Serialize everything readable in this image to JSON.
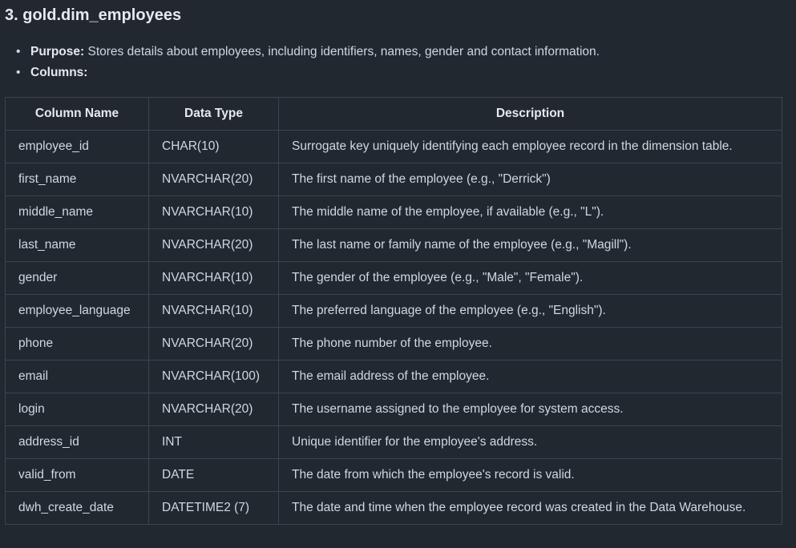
{
  "heading": "3. gold.dim_employees",
  "purpose": {
    "label": "Purpose:",
    "text": " Stores details about employees, including identifiers, names, gender and contact information."
  },
  "columns_label": "Columns:",
  "table": {
    "headers": [
      "Column Name",
      "Data Type",
      "Description"
    ],
    "rows": [
      [
        "employee_id",
        "CHAR(10)",
        "Surrogate key uniquely identifying each employee record in the dimension table."
      ],
      [
        "first_name",
        "NVARCHAR(20)",
        "The first name of the employee (e.g., \"Derrick\")"
      ],
      [
        "middle_name",
        "NVARCHAR(10)",
        "The middle name of the employee, if available (e.g., \"L\")."
      ],
      [
        "last_name",
        "NVARCHAR(20)",
        "The last name or family name of the employee (e.g., \"Magill\")."
      ],
      [
        "gender",
        "NVARCHAR(10)",
        "The gender of the employee (e.g., \"Male\", \"Female\")."
      ],
      [
        "employee_language",
        "NVARCHAR(10)",
        "The preferred language of the employee (e.g., \"English\")."
      ],
      [
        "phone",
        "NVARCHAR(20)",
        "The phone number of the employee."
      ],
      [
        "email",
        "NVARCHAR(100)",
        "The email address of the employee."
      ],
      [
        "login",
        "NVARCHAR(20)",
        "The username assigned to the employee for system access."
      ],
      [
        "address_id",
        "INT",
        "Unique identifier for the employee's address."
      ],
      [
        "valid_from",
        "DATE",
        "The date from which the employee's record is valid."
      ],
      [
        "dwh_create_date",
        "DATETIME2 (7)",
        "The date and time when the employee record was created in the Data Warehouse."
      ]
    ]
  }
}
